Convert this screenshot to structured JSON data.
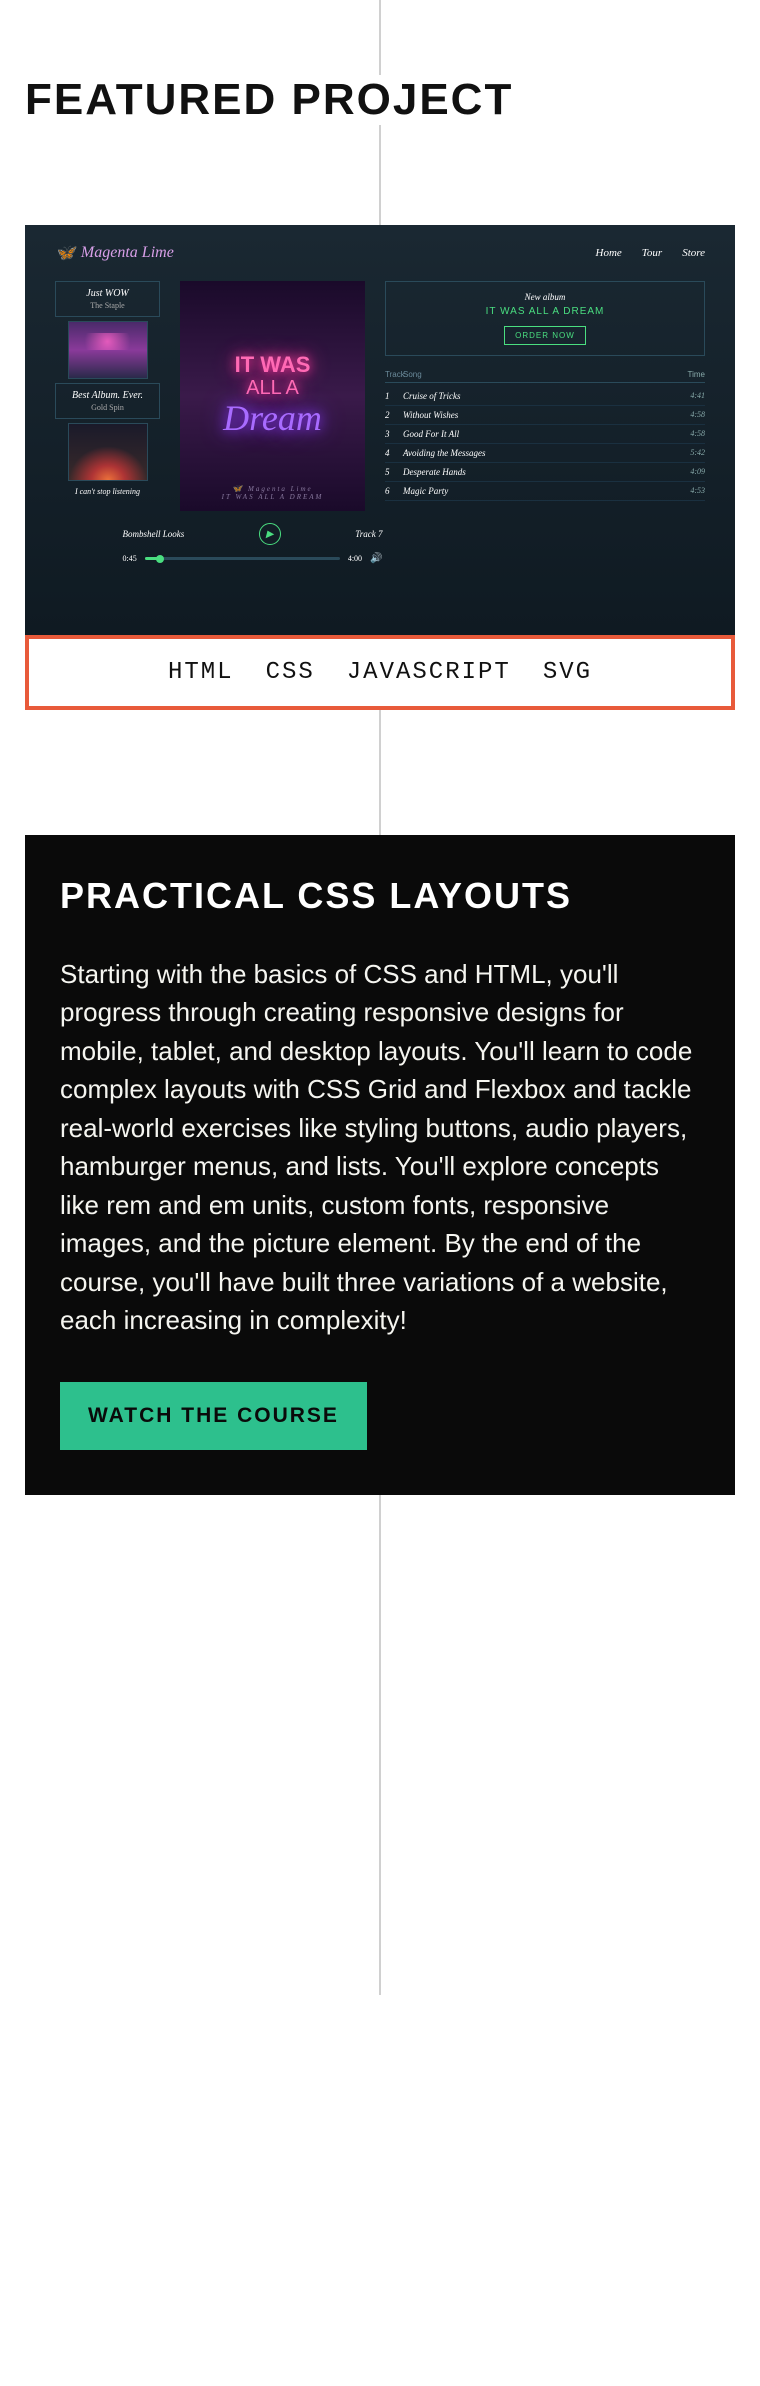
{
  "section_heading": "FEATURED PROJECT",
  "mockup": {
    "logo_text": "Magenta Lime",
    "nav": [
      "Home",
      "Tour",
      "Store"
    ],
    "left_reviews": [
      {
        "title": "Just WOW",
        "sub": "The Staple"
      },
      {
        "title": "Best Album. Ever.",
        "sub": "Gold Spin"
      }
    ],
    "cant_stop": "I can't stop listening",
    "neon_line1": "IT WAS",
    "neon_line2": "ALL A",
    "neon_dream": "Dream",
    "album_footer_brand": "Magenta Lime",
    "album_footer_title": "IT WAS ALL A DREAM",
    "player_left": "Bombshell Looks",
    "player_right": "Track 7",
    "time_current": "0:45",
    "time_total": "4:00",
    "new_album_label": "New album",
    "new_album_title": "IT WAS ALL A DREAM",
    "order_btn": "ORDER NOW",
    "track_header": {
      "num": "Track",
      "name": "Song",
      "time": "Time"
    },
    "tracks": [
      {
        "num": "1",
        "name": "Cruise of Tricks",
        "time": "4:41"
      },
      {
        "num": "2",
        "name": "Without Wishes",
        "time": "4:58"
      },
      {
        "num": "3",
        "name": "Good For It All",
        "time": "4:58"
      },
      {
        "num": "4",
        "name": "Avoiding the Messages",
        "time": "5:42"
      },
      {
        "num": "5",
        "name": "Desperate Hands",
        "time": "4:09"
      },
      {
        "num": "6",
        "name": "Magic Party",
        "time": "4:53"
      }
    ]
  },
  "tech_tags": [
    "HTML",
    "CSS",
    "JAVASCRIPT",
    "SVG"
  ],
  "course": {
    "title": "PRACTICAL CSS LAYOUTS",
    "description": "Starting with the basics of CSS and HTML, you'll progress through creating responsive designs for mobile, tablet, and desktop layouts. You'll learn to code complex layouts with CSS Grid and Flexbox and tackle real-world exercises like styling buttons, audio players, hamburger menus, and lists. You'll explore concepts like rem and em units, custom fonts, responsive images, and the picture element. By the end of the course, you'll have built three variations of a website, each increasing in complexity!",
    "cta": "WATCH THE COURSE"
  }
}
